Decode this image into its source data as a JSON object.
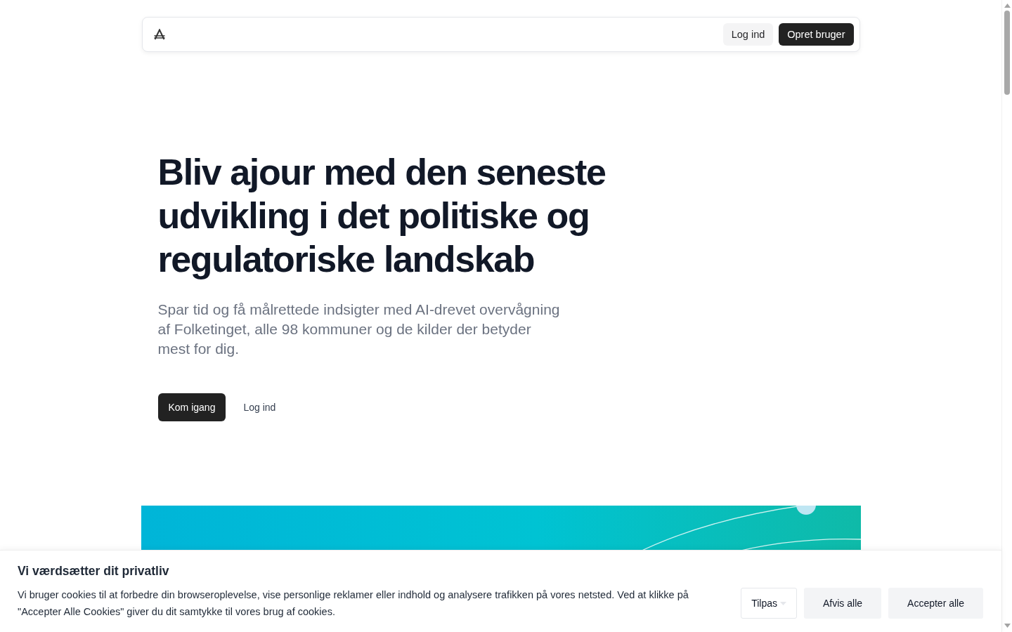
{
  "nav": {
    "buttons": [
      {
        "label": "Log ind",
        "kind": "secondary"
      },
      {
        "label": "Opret bruger",
        "kind": "primary"
      }
    ]
  },
  "hero": {
    "heading": "Bliv ajour med den seneste udvikling i det politiske og regulatoriske landskab",
    "subtitle": "Spar tid og få målrettede indsigter med AI-drevet overvågning af Folketinget, alle 98 kommuner og de kilder der betyder mest for dig.",
    "buttons": [
      {
        "label": "Kom igang",
        "kind": "primary"
      },
      {
        "label": "Log ind",
        "kind": "link"
      }
    ]
  },
  "cookie_banner": {
    "title": "Vi værdsætter dit privatliv",
    "text": "Vi bruger cookies til at forbedre din browseroplevelse, vise personlige reklamer eller indhold og analysere trafikken på vores netsted. Ved at klikke på \"Accepter Alle Cookies\" giver du dit samtykke til vores brug af cookies.",
    "buttons": [
      {
        "label": "Tilpas",
        "kind": "dropdown"
      },
      {
        "label": "Afvis alle",
        "kind": "plain"
      },
      {
        "label": "Accepter alle",
        "kind": "plain"
      }
    ]
  }
}
